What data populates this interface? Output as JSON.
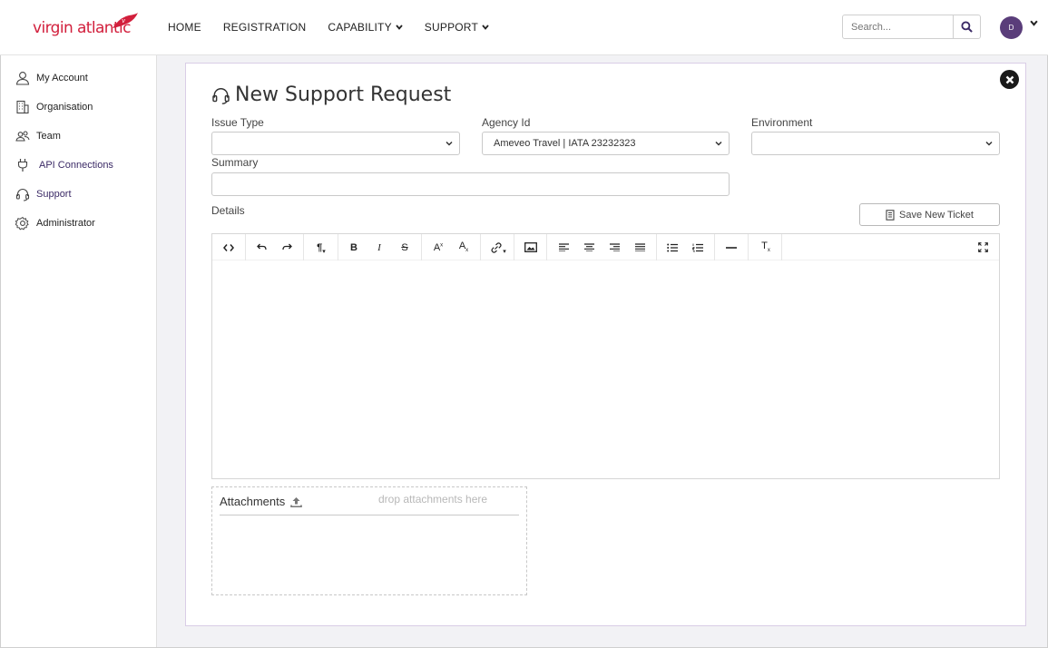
{
  "brand": {
    "logo_text": "virgin atlantic"
  },
  "nav": {
    "items": [
      {
        "label": "HOME",
        "has_caret": false
      },
      {
        "label": "REGISTRATION",
        "has_caret": false
      },
      {
        "label": "CAPABILITY",
        "has_caret": true
      },
      {
        "label": "SUPPORT",
        "has_caret": true
      }
    ],
    "search_placeholder": "Search...",
    "avatar_initial": "D"
  },
  "sidebar": {
    "items": [
      {
        "label": "My Account",
        "icon": "user-icon"
      },
      {
        "label": "Organisation",
        "icon": "building-icon"
      },
      {
        "label": "Team",
        "icon": "team-icon"
      },
      {
        "label": "API Connections",
        "icon": "plug-icon"
      },
      {
        "label": "Support",
        "icon": "headset-icon"
      },
      {
        "label": "Administrator",
        "icon": "gear-icon"
      }
    ]
  },
  "form": {
    "title": "New Support Request",
    "issue_type": {
      "label": "Issue Type",
      "value": ""
    },
    "agency_id": {
      "label": "Agency Id",
      "value": "Ameveo Travel | IATA 23232323"
    },
    "environment": {
      "label": "Environment",
      "value": ""
    },
    "summary": {
      "label": "Summary",
      "value": ""
    },
    "details_label": "Details",
    "save_label": "Save New Ticket",
    "attachments": {
      "title": "Attachments",
      "hint": "drop attachments here"
    }
  },
  "editor_toolbar": {
    "buttons": [
      "code-view",
      "undo",
      "redo",
      "paragraph",
      "bold",
      "italic",
      "strikethrough",
      "superscript",
      "subscript",
      "link",
      "image",
      "align-left",
      "align-center",
      "align-right",
      "align-justify",
      "bullet-list",
      "numbered-list",
      "horizontal-rule",
      "clear-format",
      "fullscreen"
    ],
    "bold_glyph": "B",
    "italic_glyph": "I",
    "strike_glyph": "S",
    "superscript_glyph": "A",
    "superscript_mark": "x",
    "subscript_glyph": "A",
    "subscript_mark": "x",
    "clear_glyph": "T",
    "clear_mark": "x",
    "paragraph_glyph": "¶"
  },
  "colors": {
    "brand_red": "#d21f3c",
    "avatar_purple": "#5a3d7a",
    "accent_text": "#3b2a66"
  }
}
